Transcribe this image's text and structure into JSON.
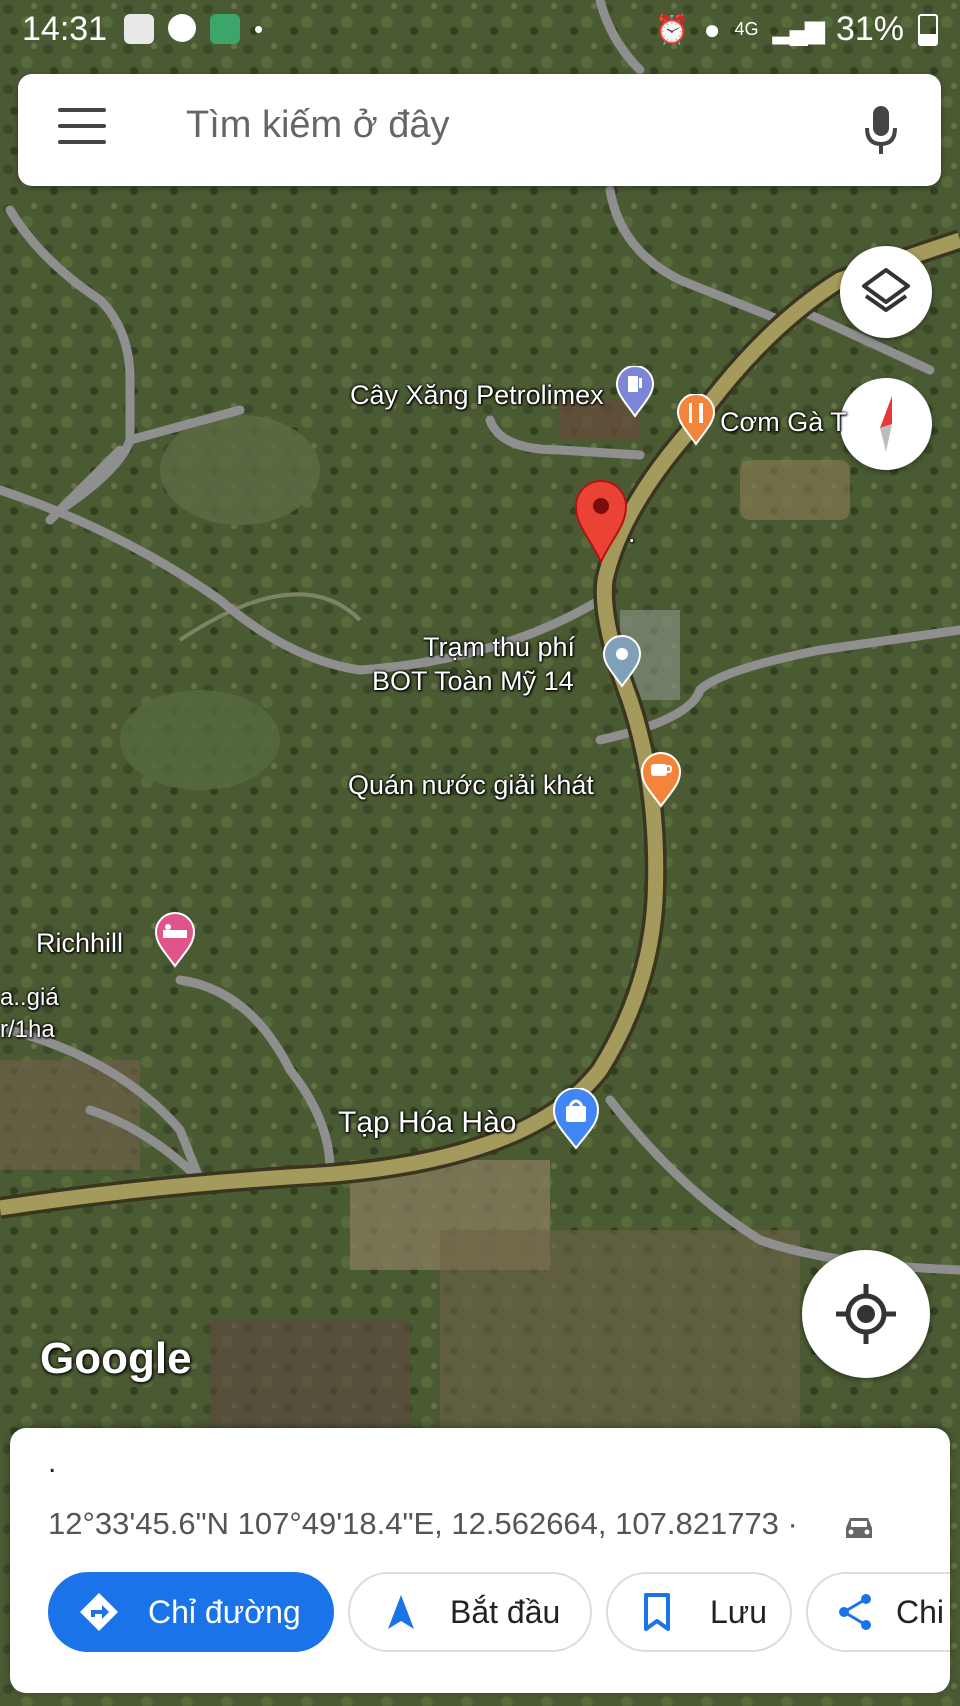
{
  "status_bar": {
    "time": "14:31",
    "network": "4G",
    "battery": "31%"
  },
  "search": {
    "placeholder": "Tìm kiếm ở đây"
  },
  "map": {
    "labels": [
      {
        "name": "Cây Xăng Petrolimex",
        "icon": "gas-station-icon",
        "color": "#7b86d8"
      },
      {
        "name": "Cơm Gà T",
        "icon": "restaurant-icon",
        "color": "#f2853b"
      },
      {
        "name": "Trạm thu phí",
        "name2": "BOT Toàn Mỹ 14",
        "icon": "place-icon",
        "color": "#7fa1b8"
      },
      {
        "name": "Quán nước giải khát",
        "icon": "cafe-icon",
        "color": "#f2853b"
      },
      {
        "name": "Richhill",
        "icon": "hotel-icon",
        "color": "#e0548c"
      },
      {
        "name": "Tạp Hóa Hào",
        "icon": "shopping-icon",
        "color": "#4285f4"
      },
      {
        "name": "a..giá",
        "name2": "r/1ha",
        "icon": "",
        "color": ""
      }
    ],
    "dropped_pin_label": ".",
    "attribution": "Google"
  },
  "place_sheet": {
    "title": ".",
    "coordinates": "12°33'45.6\"N 107°49'18.4\"E, 12.562664, 107.821773 ·",
    "buttons": {
      "directions": "Chỉ đường",
      "start": "Bắt đầu",
      "save": "Lưu",
      "share": "Chi"
    }
  },
  "colors": {
    "accent": "#1a73e8",
    "pin": "#ea4335",
    "road": "#a49a5c"
  }
}
